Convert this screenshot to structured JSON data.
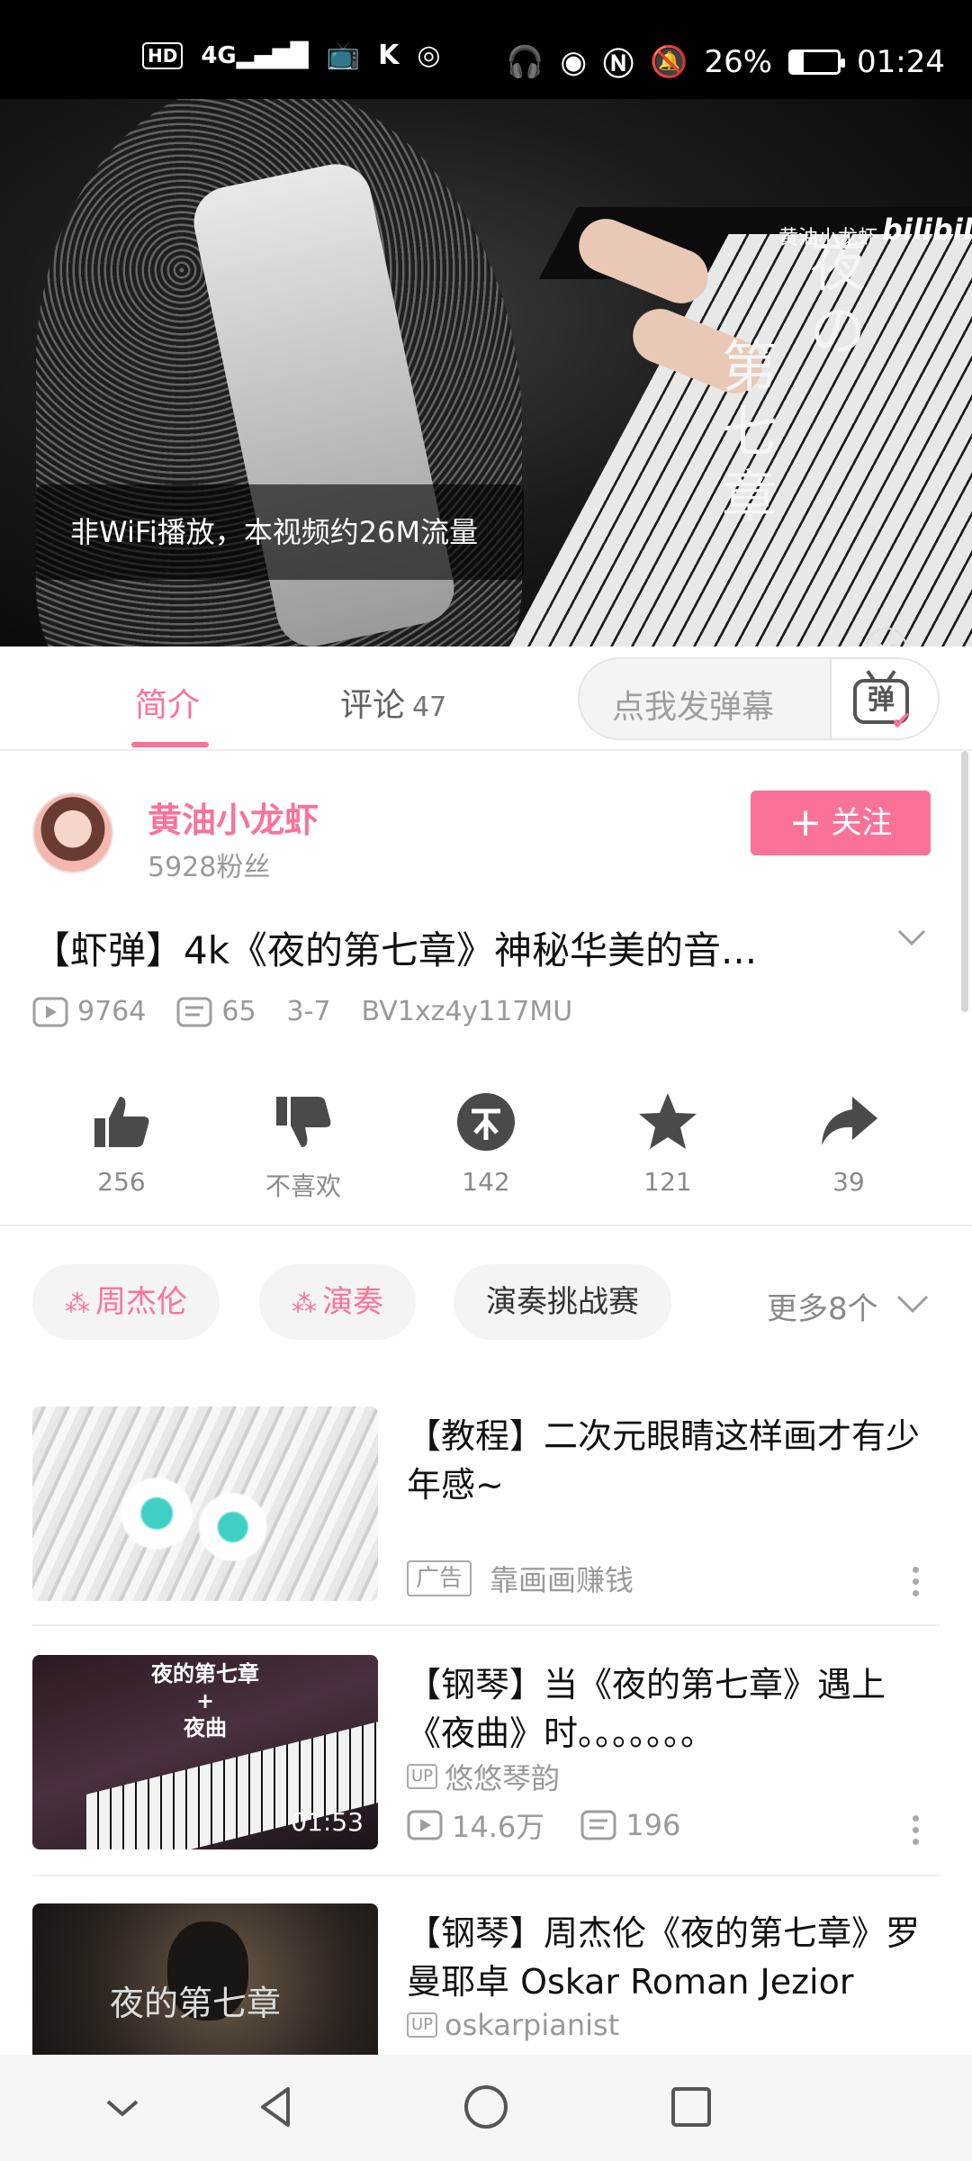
{
  "status_bar": {
    "left_items": [
      "HD",
      "4G",
      "signal",
      "tv",
      "K",
      "hotspot"
    ],
    "battery": "26%",
    "battery_level": 0.26,
    "time": "01:24"
  },
  "video": {
    "watermark_text": "黄油小龙虾",
    "watermark_logo": "bilibili",
    "overlay_title_col1": "夜の",
    "overlay_title_col2": "第七章",
    "data_toast": "非WiFi播放，本视频约26M流量"
  },
  "tabs": {
    "intro": "简介",
    "comments": "评论",
    "comments_count": "47",
    "danmaku_placeholder": "点我发弹幕",
    "danmaku_button": "弹"
  },
  "uploader": {
    "name": "黄油小龙虾",
    "fans": "5928粉丝",
    "follow": "关注"
  },
  "detail": {
    "title": "【虾弹】4k《夜的第七章》神秘华美的音...",
    "views": "9764",
    "danmaku_count": "65",
    "date": "3-7",
    "bvid": "BV1xz4y117MU"
  },
  "actions": [
    {
      "icon": "like-icon",
      "label": "256"
    },
    {
      "icon": "dislike-icon",
      "label": "不喜欢"
    },
    {
      "icon": "coin-icon",
      "label": "142"
    },
    {
      "icon": "star-icon",
      "label": "121"
    },
    {
      "icon": "share-icon",
      "label": "39"
    }
  ],
  "tags": [
    "周杰伦",
    "演奏",
    "演奏挑战赛"
  ],
  "tags_more": "更多8个",
  "recommendations": [
    {
      "title": "【教程】二次元眼睛这样画才有少年感~",
      "ad_label": "广告",
      "source": "靠画画赚钱"
    },
    {
      "title": "【钢琴】当《夜的第七章》遇上《夜曲》时。。。。。。。",
      "thumb_text_1": "夜的第七章",
      "thumb_text_2": "+",
      "thumb_text_3": "夜曲",
      "duration": "01:53",
      "uploader": "悠悠琴韵",
      "views": "14.6万",
      "danmaku": "196"
    },
    {
      "title": "【钢琴】周杰伦《夜的第七章》罗曼耶卓 Oskar Roman Jezior",
      "thumb_text": "夜的第七章",
      "uploader": "oskarpianist"
    }
  ],
  "badges": {
    "up": "UP"
  },
  "colors": {
    "accent": "#fb7299",
    "background": "#ffffff",
    "status_bar": "#000000"
  }
}
